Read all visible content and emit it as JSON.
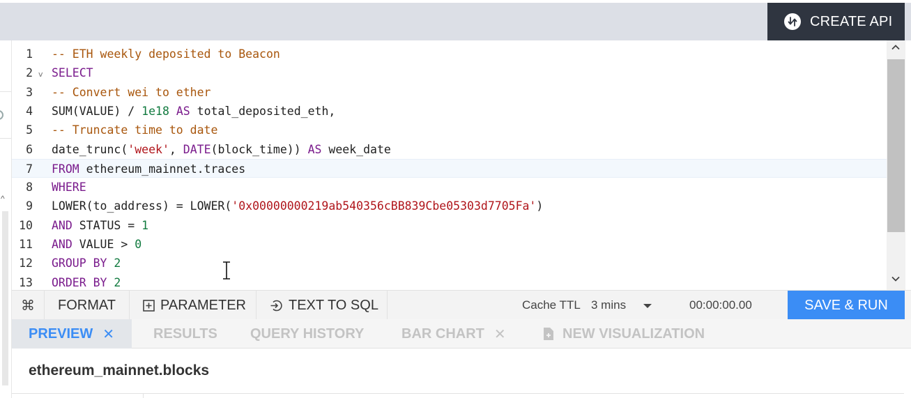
{
  "header": {
    "create_api_label": "CREATE API",
    "create_api_icon": "swap-vertical-icon"
  },
  "editor": {
    "lines": [
      {
        "no": "1",
        "tokens": [
          {
            "t": "-- ETH weekly deposited to Beacon",
            "k": "cm"
          }
        ]
      },
      {
        "no": "2",
        "fold": "v",
        "tokens": [
          {
            "t": "SELECT",
            "k": "kw"
          }
        ]
      },
      {
        "no": "3",
        "tokens": [
          {
            "t": "-- Convert wei to ether",
            "k": "cm"
          }
        ]
      },
      {
        "no": "4",
        "tokens": [
          {
            "t": "SUM(VALUE) / ",
            "k": "id"
          },
          {
            "t": "1e18",
            "k": "num"
          },
          {
            "t": " ",
            "k": "id"
          },
          {
            "t": "AS",
            "k": "kw"
          },
          {
            "t": " total_deposited_eth,",
            "k": "id"
          }
        ]
      },
      {
        "no": "5",
        "tokens": [
          {
            "t": "-- Truncate time to date",
            "k": "cm"
          }
        ]
      },
      {
        "no": "6",
        "tokens": [
          {
            "t": "date_trunc(",
            "k": "id"
          },
          {
            "t": "'week'",
            "k": "str"
          },
          {
            "t": ", ",
            "k": "id"
          },
          {
            "t": "DATE",
            "k": "kw"
          },
          {
            "t": "(block_time)) ",
            "k": "id"
          },
          {
            "t": "AS",
            "k": "kw"
          },
          {
            "t": " week_date",
            "k": "id"
          }
        ]
      },
      {
        "no": "7",
        "active": true,
        "tokens": [
          {
            "t": "FROM",
            "k": "kw"
          },
          {
            "t": " ethereum_mainnet.traces",
            "k": "id"
          }
        ]
      },
      {
        "no": "8",
        "tokens": [
          {
            "t": "WHERE",
            "k": "kw"
          }
        ]
      },
      {
        "no": "9",
        "tokens": [
          {
            "t": "LOWER(to_address) = LOWER(",
            "k": "id"
          },
          {
            "t": "'0x00000000219ab540356cBB839Cbe05303d7705Fa'",
            "k": "str"
          },
          {
            "t": ")",
            "k": "id"
          }
        ]
      },
      {
        "no": "10",
        "tokens": [
          {
            "t": "AND",
            "k": "kw"
          },
          {
            "t": " STATUS = ",
            "k": "id"
          },
          {
            "t": "1",
            "k": "num"
          }
        ]
      },
      {
        "no": "11",
        "tokens": [
          {
            "t": "AND",
            "k": "kw"
          },
          {
            "t": " VALUE > ",
            "k": "id"
          },
          {
            "t": "0",
            "k": "num"
          }
        ]
      },
      {
        "no": "12",
        "tokens": [
          {
            "t": "GROUP BY",
            "k": "kw"
          },
          {
            "t": " ",
            "k": "id"
          },
          {
            "t": "2",
            "k": "num"
          }
        ]
      },
      {
        "no": "13",
        "tokens": [
          {
            "t": "ORDER BY",
            "k": "kw"
          },
          {
            "t": " ",
            "k": "id"
          },
          {
            "t": "2",
            "k": "num"
          }
        ]
      }
    ]
  },
  "toolbar": {
    "command_icon": "⌘",
    "format_label": "FORMAT",
    "parameter_label": "PARAMETER",
    "text_to_sql_label": "TEXT TO SQL",
    "cache_label": "Cache TTL",
    "cache_value": "3 mins",
    "timer": "00:00:00.00",
    "save_run_label": "SAVE & RUN"
  },
  "tabs": {
    "preview": {
      "label": "PREVIEW",
      "close": "✕"
    },
    "results": {
      "label": "RESULTS"
    },
    "history": {
      "label": "QUERY HISTORY"
    },
    "bar_chart": {
      "label": "BAR CHART",
      "close": "✕"
    },
    "new_viz": {
      "label": "NEW VISUALIZATION"
    }
  },
  "content": {
    "title": "ethereum_mainnet.blocks"
  },
  "colors": {
    "accent": "#3b8df5",
    "dark_button": "#2f3540",
    "comment": "#a8560c",
    "keyword": "#7a1b8c",
    "string": "#b0151b",
    "number": "#117a3f"
  }
}
